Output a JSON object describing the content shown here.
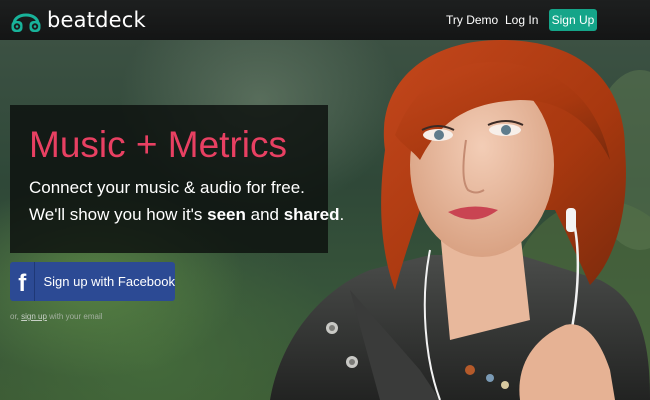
{
  "brand": {
    "name": "beatdeck",
    "logo_icon": "headphones-icon"
  },
  "nav": {
    "try_demo": "Try Demo",
    "log_in": "Log In",
    "sign_up": "Sign Up"
  },
  "hero": {
    "headline": "Music + Metrics",
    "line1": "Connect your music & audio for free.",
    "line2_prefix": "We'll show you how it's ",
    "line2_seen": "seen",
    "line2_and": " and ",
    "line2_shared": "shared",
    "line2_suffix": "."
  },
  "facebook": {
    "icon": "f",
    "label": "Sign up with Facebook"
  },
  "email_signup": {
    "prefix": "or, ",
    "link": "sign up",
    "suffix": " with your email"
  },
  "colors": {
    "accent": "#e84062",
    "signup_button": "#15a589",
    "facebook": "#2c4a94"
  }
}
